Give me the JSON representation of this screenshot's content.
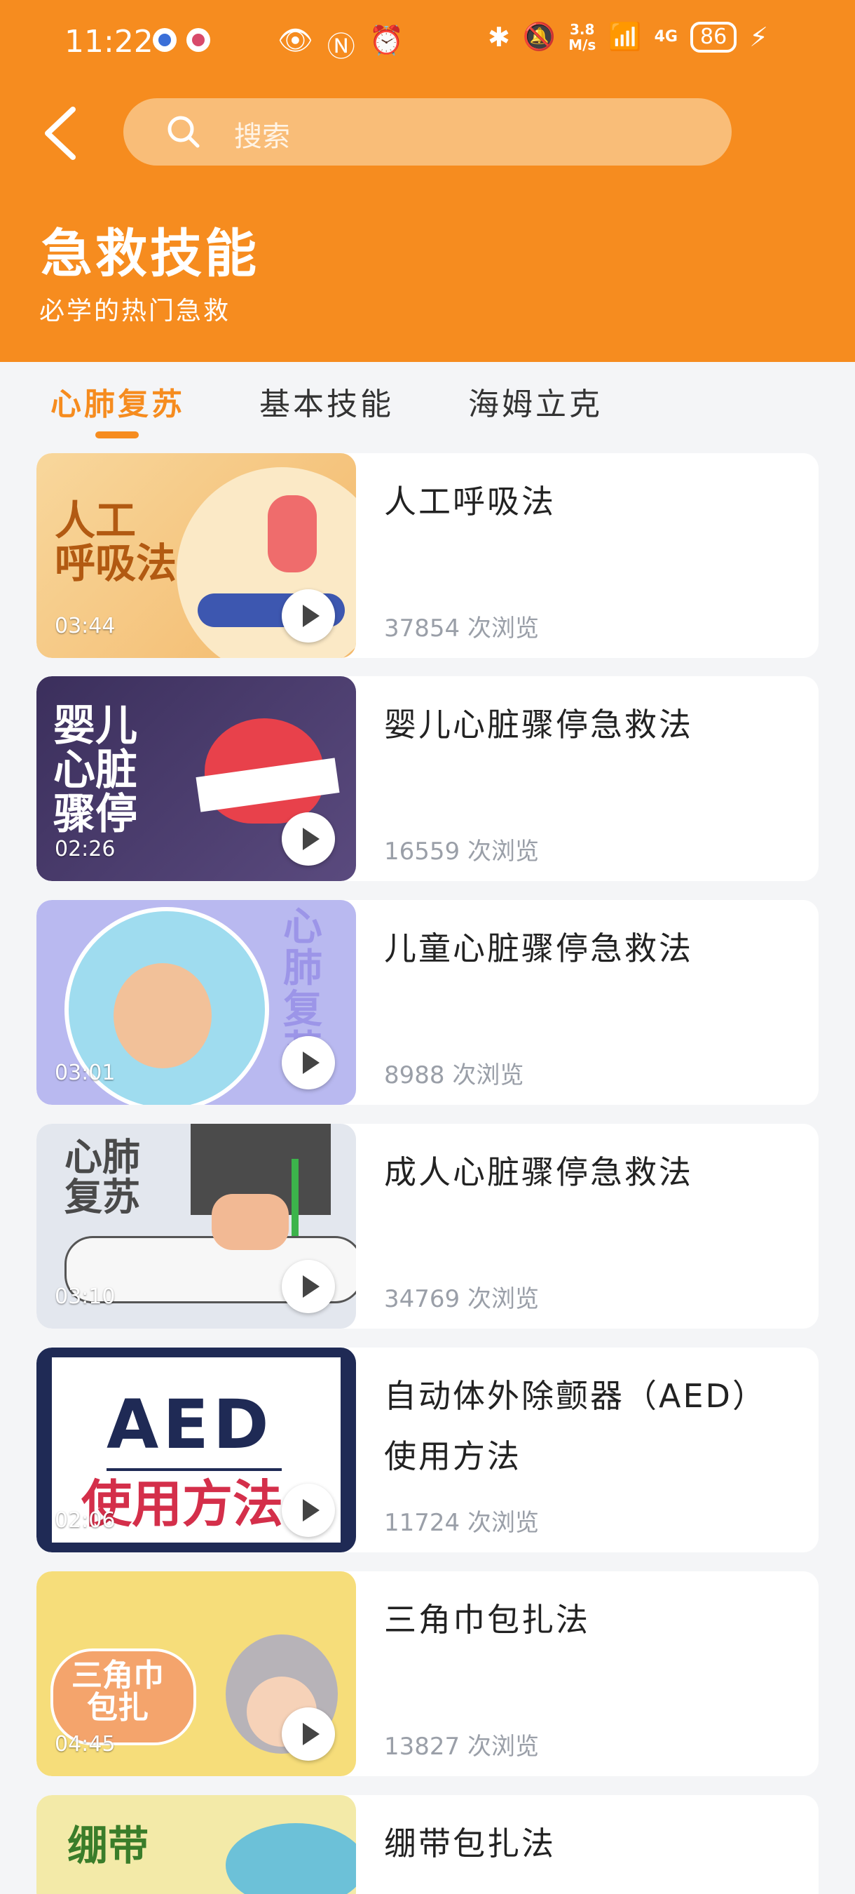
{
  "status": {
    "time": "11:22",
    "net_speed": "3.8\nM/s",
    "signal": "4G",
    "battery": "86"
  },
  "header": {
    "search_placeholder": "搜索",
    "title": "急救技能",
    "subtitle": "必学的热门急救"
  },
  "tabs": [
    {
      "label": "心肺复苏",
      "active": true
    },
    {
      "label": "基本技能",
      "active": false
    },
    {
      "label": "海姆立克",
      "active": false
    }
  ],
  "views_suffix": "次浏览",
  "items": [
    {
      "title": "人工呼吸法",
      "views": "37854",
      "duration": "03:44",
      "thumb_text": "人工\n呼吸法",
      "thumb_bg": "#f5c27a"
    },
    {
      "title": "婴儿心脏骤停急救法",
      "views": "16559",
      "duration": "02:26",
      "thumb_text": "婴儿\n心脏\n骤停",
      "thumb_bg": "#4a3b6a"
    },
    {
      "title": "儿童心脏骤停急救法",
      "views": "8988",
      "duration": "03:01",
      "thumb_text": "心肺复苏",
      "thumb_bg": "#b9b9f0"
    },
    {
      "title": "成人心脏骤停急救法",
      "views": "34769",
      "duration": "03:10",
      "thumb_text": "心肺\n复苏",
      "thumb_bg": "#dfe3ea"
    },
    {
      "title": "自动体外除颤器（AED）使用方法",
      "views": "11724",
      "duration": "02:06",
      "thumb_text": "AED",
      "thumb_text2": "使用方法",
      "thumb_bg": "#1f2a55"
    },
    {
      "title": "三角巾包扎法",
      "views": "13827",
      "duration": "04:45",
      "thumb_text": "三角巾\n包扎",
      "thumb_bg": "#f6dd7a"
    },
    {
      "title": "绷带包扎法",
      "views": "",
      "duration": "",
      "thumb_text": "绷带",
      "thumb_bg": "#f3eaa8"
    }
  ]
}
